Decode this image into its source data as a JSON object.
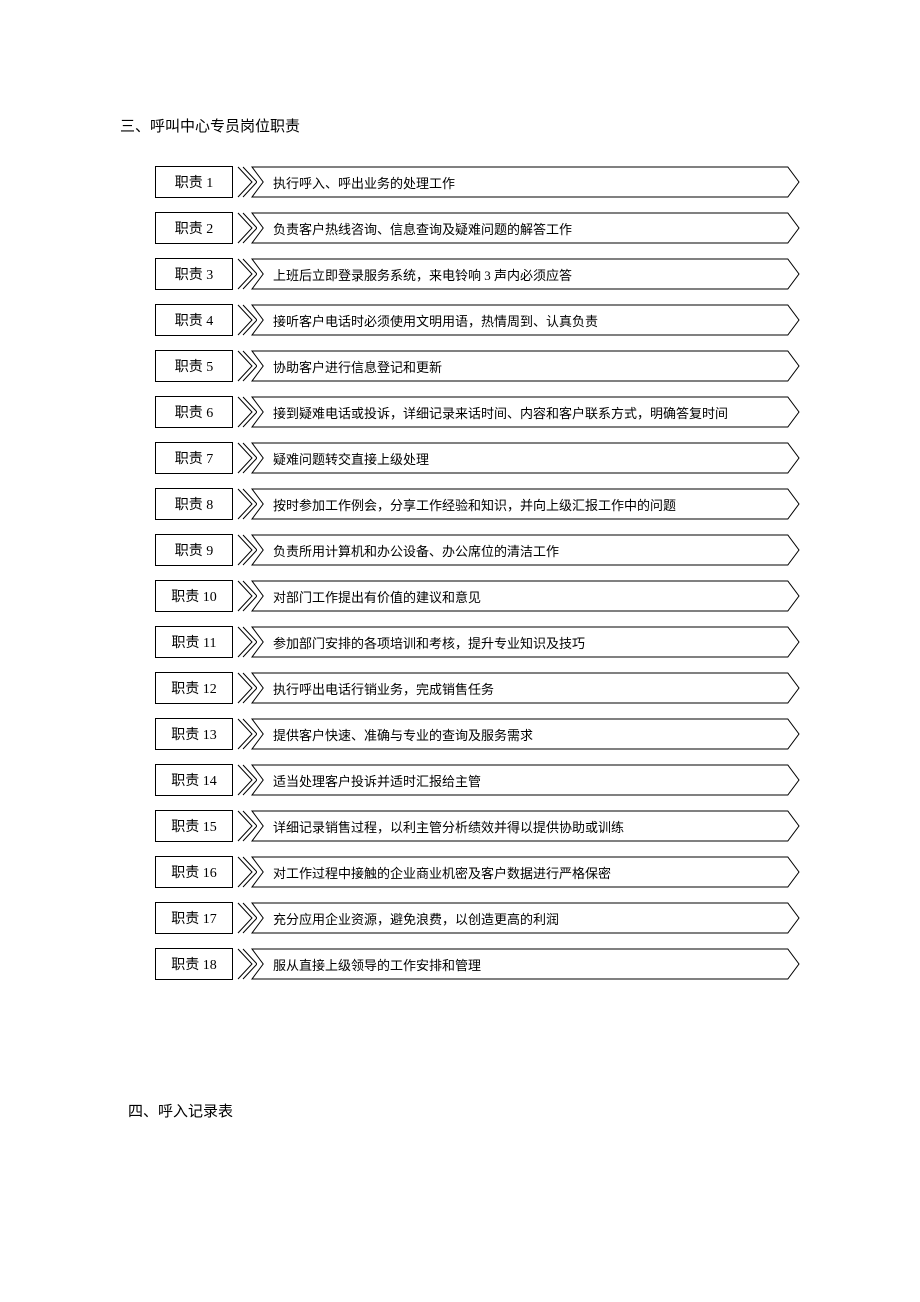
{
  "section1_title": "三、呼叫中心专员岗位职责",
  "duties": [
    {
      "label": "职责 1",
      "desc": "执行呼入、呼出业务的处理工作"
    },
    {
      "label": "职责 2",
      "desc": "负责客户热线咨询、信息查询及疑难问题的解答工作"
    },
    {
      "label": "职责 3",
      "desc": "上班后立即登录服务系统，来电铃响 3 声内必须应答"
    },
    {
      "label": "职责 4",
      "desc": "接听客户电话时必须使用文明用语，热情周到、认真负责"
    },
    {
      "label": "职责 5",
      "desc": "协助客户进行信息登记和更新"
    },
    {
      "label": "职责 6",
      "desc": "接到疑难电话或投诉，详细记录来话时间、内容和客户联系方式，明确答复时间"
    },
    {
      "label": "职责 7",
      "desc": "疑难问题转交直接上级处理"
    },
    {
      "label": "职责 8",
      "desc": "按时参加工作例会，分享工作经验和知识，并向上级汇报工作中的问题"
    },
    {
      "label": "职责 9",
      "desc": "负责所用计算机和办公设备、办公席位的清洁工作"
    },
    {
      "label": "职责 10",
      "desc": "对部门工作提出有价值的建议和意见"
    },
    {
      "label": "职责 11",
      "desc": "参加部门安排的各项培训和考核，提升专业知识及技巧"
    },
    {
      "label": "职责 12",
      "desc": "执行呼出电话行销业务，完成销售任务"
    },
    {
      "label": "职责 13",
      "desc": "提供客户快速、准确与专业的查询及服务需求"
    },
    {
      "label": "职责 14",
      "desc": "适当处理客户投诉并适时汇报给主管"
    },
    {
      "label": "职责 15",
      "desc": "详细记录销售过程，以利主管分析绩效并得以提供协助或训练"
    },
    {
      "label": "职责 16",
      "desc": "对工作过程中接触的企业商业机密及客户数据进行严格保密"
    },
    {
      "label": "职责 17",
      "desc": "充分应用企业资源，避免浪费，以创造更高的利润"
    },
    {
      "label": "职责 18",
      "desc": "服从直接上级领导的工作安排和管理"
    }
  ],
  "section2_title": "四、呼入记录表"
}
